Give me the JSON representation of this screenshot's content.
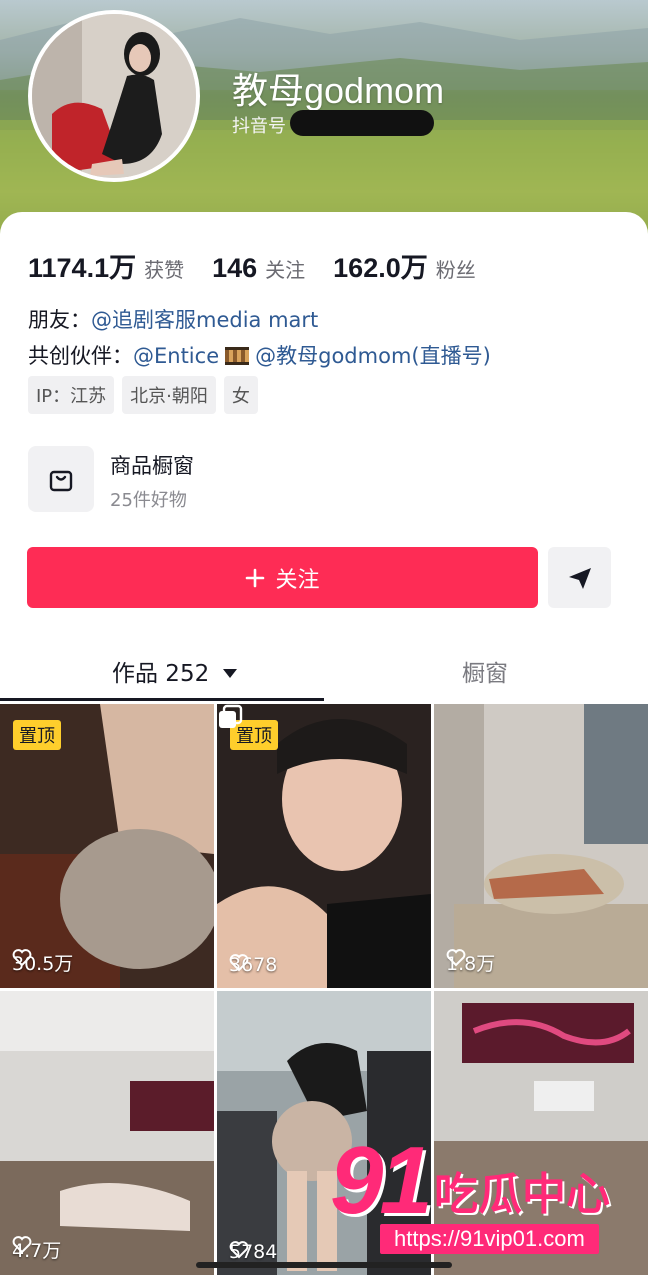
{
  "profile": {
    "username": "教母godmom",
    "douyin_id_label": "抖音号"
  },
  "stats": [
    {
      "value": "1174.1万",
      "label": "获赞"
    },
    {
      "value": "146",
      "label": "关注"
    },
    {
      "value": "162.0万",
      "label": "粉丝"
    }
  ],
  "bio": {
    "friends_label": "朋友：",
    "friends_link": "@追剧客服media mart",
    "cocreate_label": "共创伙伴：",
    "cocreate_link1": "@Entice",
    "cocreate_link2": "@教母godmom(直播号)"
  },
  "tags": [
    "IP：江苏",
    "北京·朝阳",
    "女"
  ],
  "shop": {
    "title": "商品橱窗",
    "subtitle": "25件好物"
  },
  "actions": {
    "follow_label": "关注",
    "follow_icon": "plus-icon",
    "share_icon": "send-icon"
  },
  "tabs": [
    {
      "label": "作品 252",
      "active": true
    },
    {
      "label": "橱窗",
      "active": false
    }
  ],
  "videos": [
    {
      "pinned": true,
      "pin_label": "置顶",
      "likes": "30.5万",
      "multi": false
    },
    {
      "pinned": true,
      "pin_label": "置顶",
      "likes": "3678",
      "multi": true
    },
    {
      "pinned": false,
      "pin_label": "",
      "likes": "1.8万",
      "multi": false
    },
    {
      "pinned": false,
      "pin_label": "",
      "likes": "4.7万",
      "multi": false
    },
    {
      "pinned": false,
      "pin_label": "",
      "likes": "5784",
      "multi": false
    },
    {
      "pinned": false,
      "pin_label": "",
      "likes": "",
      "multi": false
    }
  ],
  "watermark": {
    "number": "91",
    "text": "吃瓜中心",
    "url": "https://91vip01.com"
  },
  "colors": {
    "accent": "#fe2c55",
    "link": "#2f5a93",
    "pin": "#fece2c",
    "watermark": "#ff2a78"
  }
}
